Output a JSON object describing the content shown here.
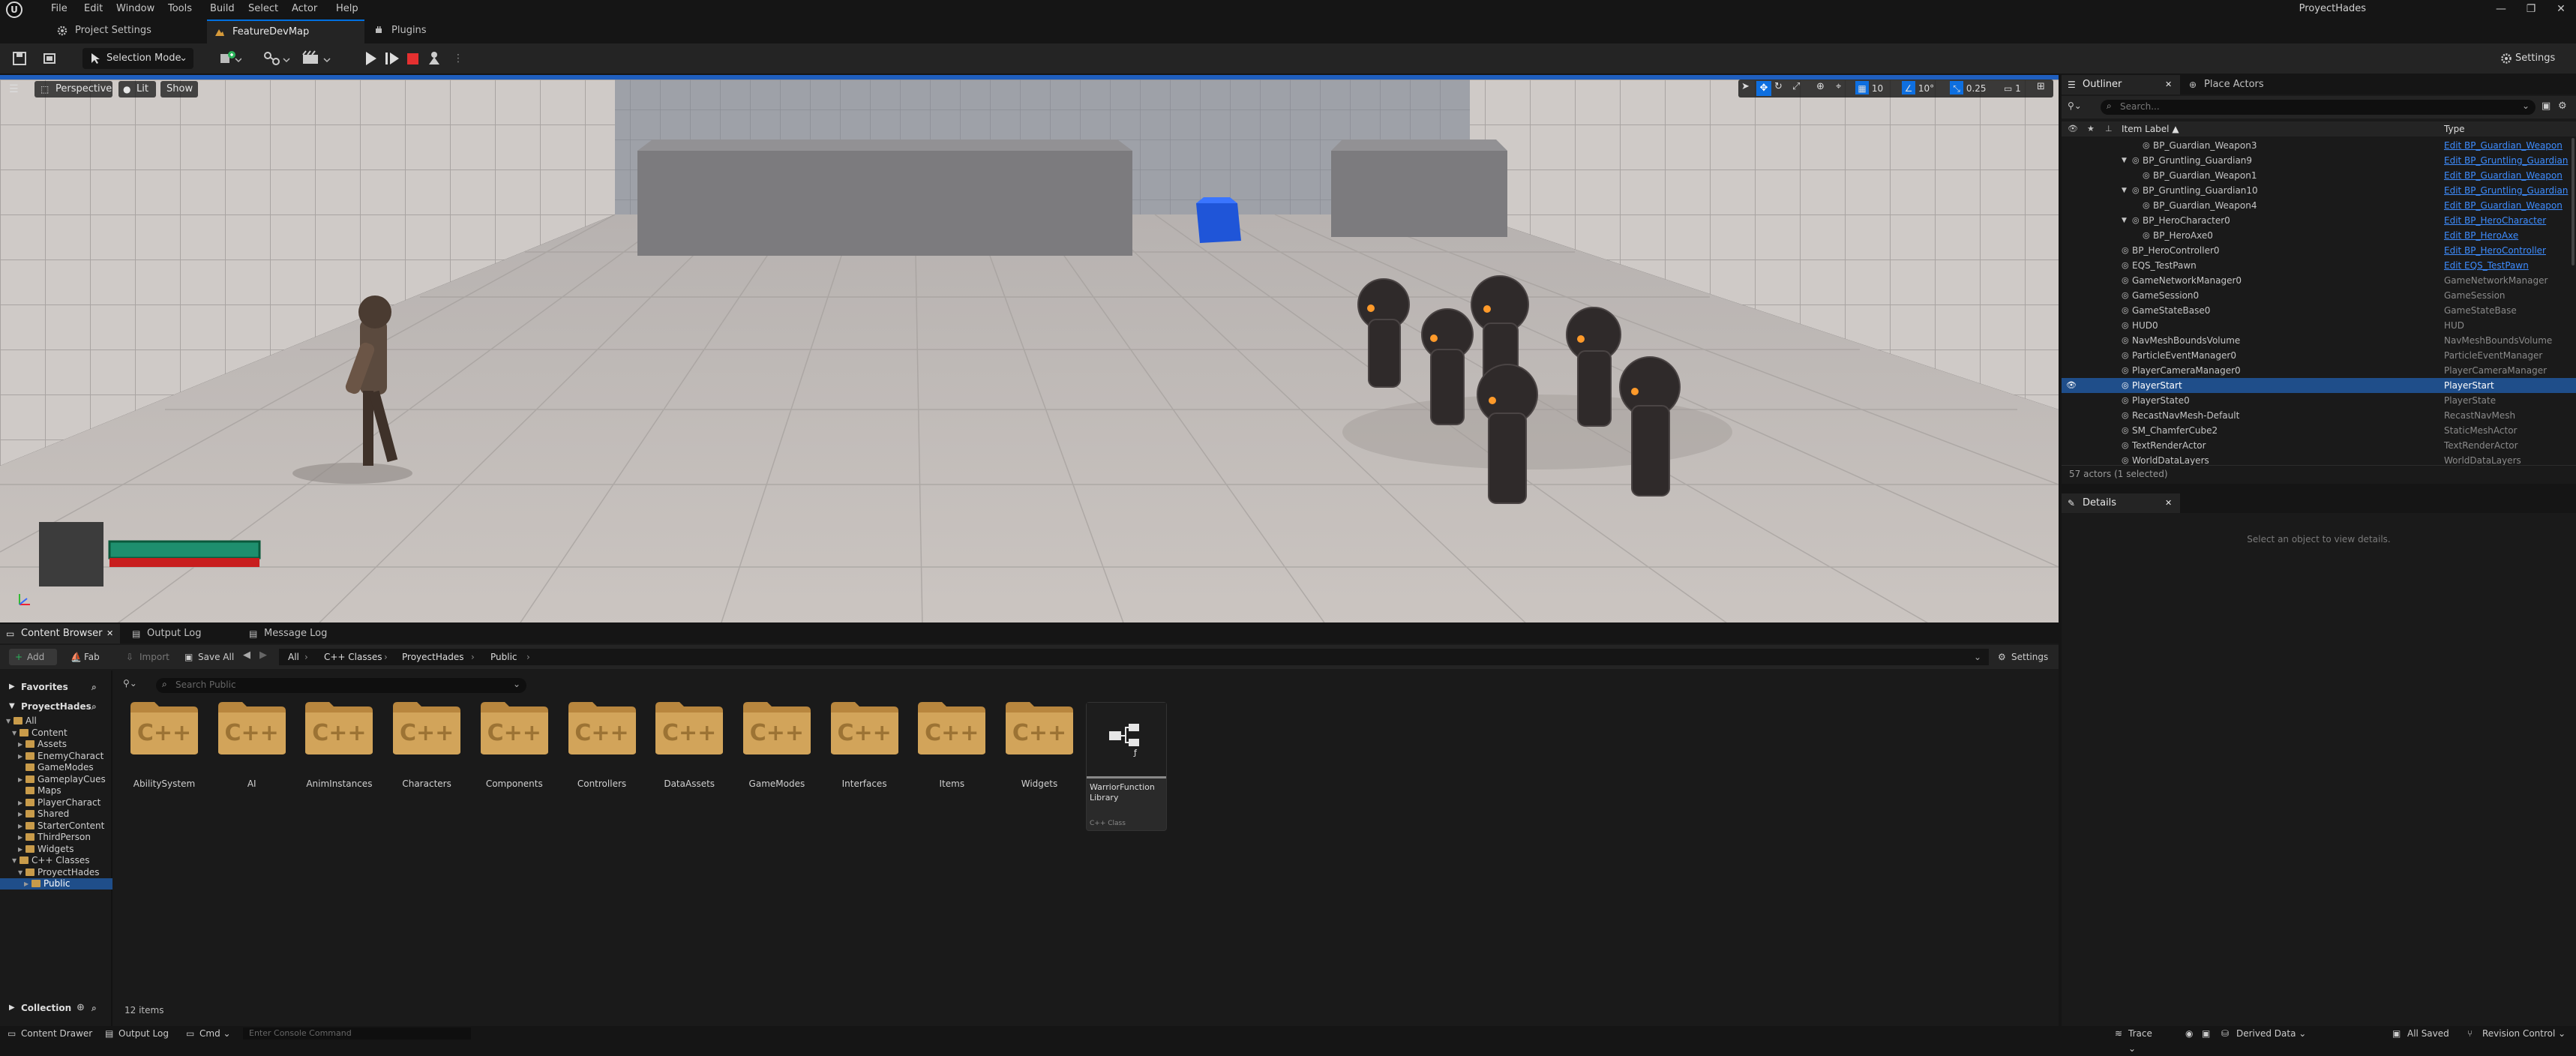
{
  "menu": {
    "items": [
      "File",
      "Edit",
      "Window",
      "Tools",
      "Build",
      "Select",
      "Actor",
      "Help"
    ]
  },
  "window": {
    "title": "ProyectHades",
    "minimize": "—",
    "restore": "❐",
    "close": "✕"
  },
  "tabs": {
    "project_settings": "Project Settings",
    "map": "FeatureDevMap",
    "plugins": "Plugins"
  },
  "toolbar": {
    "selection_mode": "Selection Mode",
    "settings": "Settings"
  },
  "viewport": {
    "perspective": "Perspective",
    "lit": "Lit",
    "show": "Show",
    "grid_snap": "10",
    "rot_snap": "10°",
    "scale_snap": "0.25",
    "camera_speed": "1"
  },
  "outliner": {
    "tab_label": "Outliner",
    "place_actors_tab": "Place Actors",
    "search_placeholder": "Search...",
    "col_label": "Item Label ▲",
    "col_type": "Type",
    "rows": [
      {
        "label": "BP_Guardian_Weapon3",
        "type": "Edit BP_Guardian_Weapon",
        "link": true,
        "indent": 3
      },
      {
        "label": "BP_Gruntling_Guardian9",
        "type": "Edit BP_Gruntling_Guardian",
        "link": true,
        "indent": 2
      },
      {
        "label": "BP_Guardian_Weapon1",
        "type": "Edit BP_Guardian_Weapon",
        "link": true,
        "indent": 3
      },
      {
        "label": "BP_Gruntling_Guardian10",
        "type": "Edit BP_Gruntling_Guardian",
        "link": true,
        "indent": 2
      },
      {
        "label": "BP_Guardian_Weapon4",
        "type": "Edit BP_Guardian_Weapon",
        "link": true,
        "indent": 3
      },
      {
        "label": "BP_HeroCharacter0",
        "type": "Edit BP_HeroCharacter",
        "link": true,
        "indent": 2
      },
      {
        "label": "BP_HeroAxe0",
        "type": "Edit BP_HeroAxe",
        "link": true,
        "indent": 3
      },
      {
        "label": "BP_HeroController0",
        "type": "Edit BP_HeroController",
        "link": true,
        "indent": 1
      },
      {
        "label": "EQS_TestPawn",
        "type": "Edit EQS_TestPawn",
        "link": true,
        "indent": 1
      },
      {
        "label": "GameNetworkManager0",
        "type": "GameNetworkManager",
        "link": false,
        "indent": 1
      },
      {
        "label": "GameSession0",
        "type": "GameSession",
        "link": false,
        "indent": 1
      },
      {
        "label": "GameStateBase0",
        "type": "GameStateBase",
        "link": false,
        "indent": 1
      },
      {
        "label": "HUD0",
        "type": "HUD",
        "link": false,
        "indent": 1
      },
      {
        "label": "NavMeshBoundsVolume",
        "type": "NavMeshBoundsVolume",
        "link": false,
        "indent": 1
      },
      {
        "label": "ParticleEventManager0",
        "type": "ParticleEventManager",
        "link": false,
        "indent": 1
      },
      {
        "label": "PlayerCameraManager0",
        "type": "PlayerCameraManager",
        "link": false,
        "indent": 1
      },
      {
        "label": "PlayerStart",
        "type": "PlayerStart",
        "link": false,
        "indent": 1,
        "selected": true
      },
      {
        "label": "PlayerState0",
        "type": "PlayerState",
        "link": false,
        "indent": 1
      },
      {
        "label": "RecastNavMesh-Default",
        "type": "RecastNavMesh",
        "link": false,
        "indent": 1
      },
      {
        "label": "SM_ChamferCube2",
        "type": "StaticMeshActor",
        "link": false,
        "indent": 1
      },
      {
        "label": "TextRenderActor",
        "type": "TextRenderActor",
        "link": false,
        "indent": 1
      },
      {
        "label": "WorldDataLayers",
        "type": "WorldDataLayers",
        "link": false,
        "indent": 1
      }
    ],
    "summary": "57 actors (1 selected)"
  },
  "details": {
    "tab_label": "Details",
    "empty_msg": "Select an object to view details."
  },
  "bottom_tabs": {
    "content_browser": "Content Browser",
    "output_log": "Output Log",
    "message_log": "Message Log"
  },
  "content_browser": {
    "add": "Add",
    "fab": "Fab",
    "import": "Import",
    "save_all": "Save All",
    "path": [
      "All",
      "C++ Classes",
      "ProyectHades",
      "Public"
    ],
    "settings": "Settings",
    "favorites": "Favorites",
    "project": "ProyectHades",
    "search_placeholder": "Search Public",
    "tree": [
      "All",
      "Content",
      "Assets",
      "EnemyCharact",
      "GameModes",
      "GameplayCues",
      "Maps",
      "PlayerCharact",
      "Shared",
      "StarterContent",
      "ThirdPerson",
      "Widgets",
      "C++ Classes",
      "ProyectHades",
      "Public"
    ],
    "folders": [
      "AbilitySystem",
      "AI",
      "AnimInstances",
      "Characters",
      "Components",
      "Controllers",
      "DataAssets",
      "GameModes",
      "Interfaces",
      "Items",
      "Widgets"
    ],
    "folder_badge": "C++",
    "class_item": {
      "name": "WarriorFunction Library",
      "sub": "C++ Class"
    },
    "collections": "Collection",
    "item_count": "12 items"
  },
  "statusbar": {
    "content_drawer": "Content Drawer",
    "output_log": "Output Log",
    "cmd": "Cmd",
    "console_placeholder": "Enter Console Command",
    "trace": "Trace",
    "derived_data": "Derived Data",
    "all_saved": "All Saved",
    "revision_control": "Revision Control"
  }
}
